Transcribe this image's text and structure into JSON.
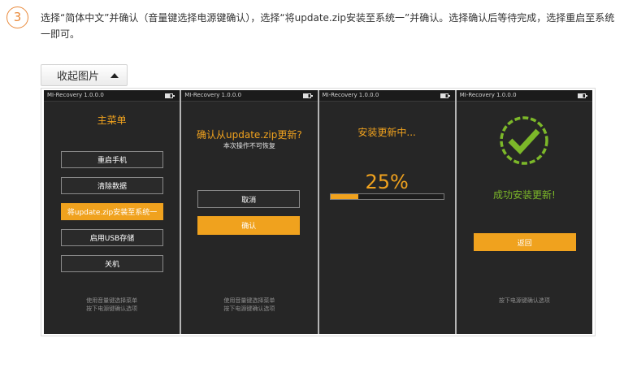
{
  "step": {
    "number": "3",
    "instruction": "选择“简体中文”并确认（音量键选择电源键确认），选择“将update.zip安装至系统一”并确认。选择确认后等待完成，选择重启至系统一即可。"
  },
  "toggle_button": {
    "label": "收起图片",
    "icon": "triangle-up-icon"
  },
  "status_bar": {
    "title": "MI-Recovery 1.0.0.0",
    "icon": "battery-icon"
  },
  "screens": {
    "main_menu": {
      "title": "主菜单",
      "items": [
        "重启手机",
        "清除数据",
        "将update.zip安装至系统一",
        "启用USB存储",
        "关机"
      ],
      "selected_index": 2,
      "hint_lines": [
        "使用音量键选择菜单",
        "按下电源键确认选项"
      ]
    },
    "confirm": {
      "question": "确认从update.zip更新?",
      "warning": "本次操作不可恢复",
      "cancel_label": "取消",
      "confirm_label": "确认",
      "hint_lines": [
        "使用音量键选择菜单",
        "按下电源键确认选项"
      ]
    },
    "installing": {
      "title": "安装更新中...",
      "percent_label": "25%",
      "progress": 0.25
    },
    "success": {
      "icon": "check-circle-icon",
      "message": "成功安装更新!",
      "back_label": "返回",
      "hint_lines": [
        "按下电源键确认选项"
      ]
    }
  },
  "colors": {
    "accent": "#f0a21e",
    "success": "#7cb829",
    "step": "#e9893a",
    "screen_bg": "#262626"
  }
}
